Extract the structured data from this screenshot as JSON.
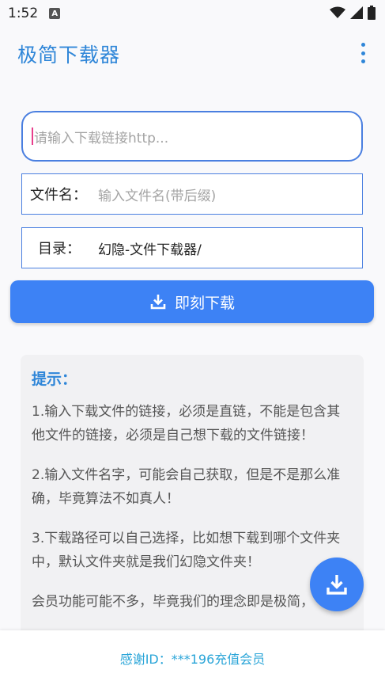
{
  "status_bar": {
    "time": "1:52",
    "notification_glyph": "A",
    "icons": [
      "wifi-icon",
      "signal-icon",
      "battery-icon"
    ]
  },
  "app_bar": {
    "title": "极简下载器",
    "menu_icon": "more-vert-icon"
  },
  "form": {
    "url_placeholder": "请输入下载链接http...",
    "filename_label": "文件名：",
    "filename_placeholder": "输入文件名(带后缀)",
    "dir_label": "目录：",
    "dir_value": "幻隐-文件下载器/"
  },
  "download_button": {
    "label": "即刻下载",
    "icon": "download-icon"
  },
  "tips": {
    "title": "提示：",
    "items": [
      "1.输入下载文件的链接，必须是直链，不能是包含其他文件的链接，必须是自己想下载的文件链接！",
      "2.输入文件名字，可能会自己获取，但是不是那么准确，毕竟算法不如真人！",
      "3.下载路径可以自己选择，比如想下载到哪个文件夹中，默认文件夹就是我们幻隐文件夹！",
      "会员功能可能不多，毕竟我们的理念即是极简，"
    ]
  },
  "fab": {
    "icon": "download-icon"
  },
  "footer": {
    "text": "感谢ID：***196充值会员"
  },
  "colors": {
    "accent": "#3d82f5",
    "title": "#2f86d8",
    "footer_text": "#2aa5d8",
    "caret": "#e83e8c"
  }
}
